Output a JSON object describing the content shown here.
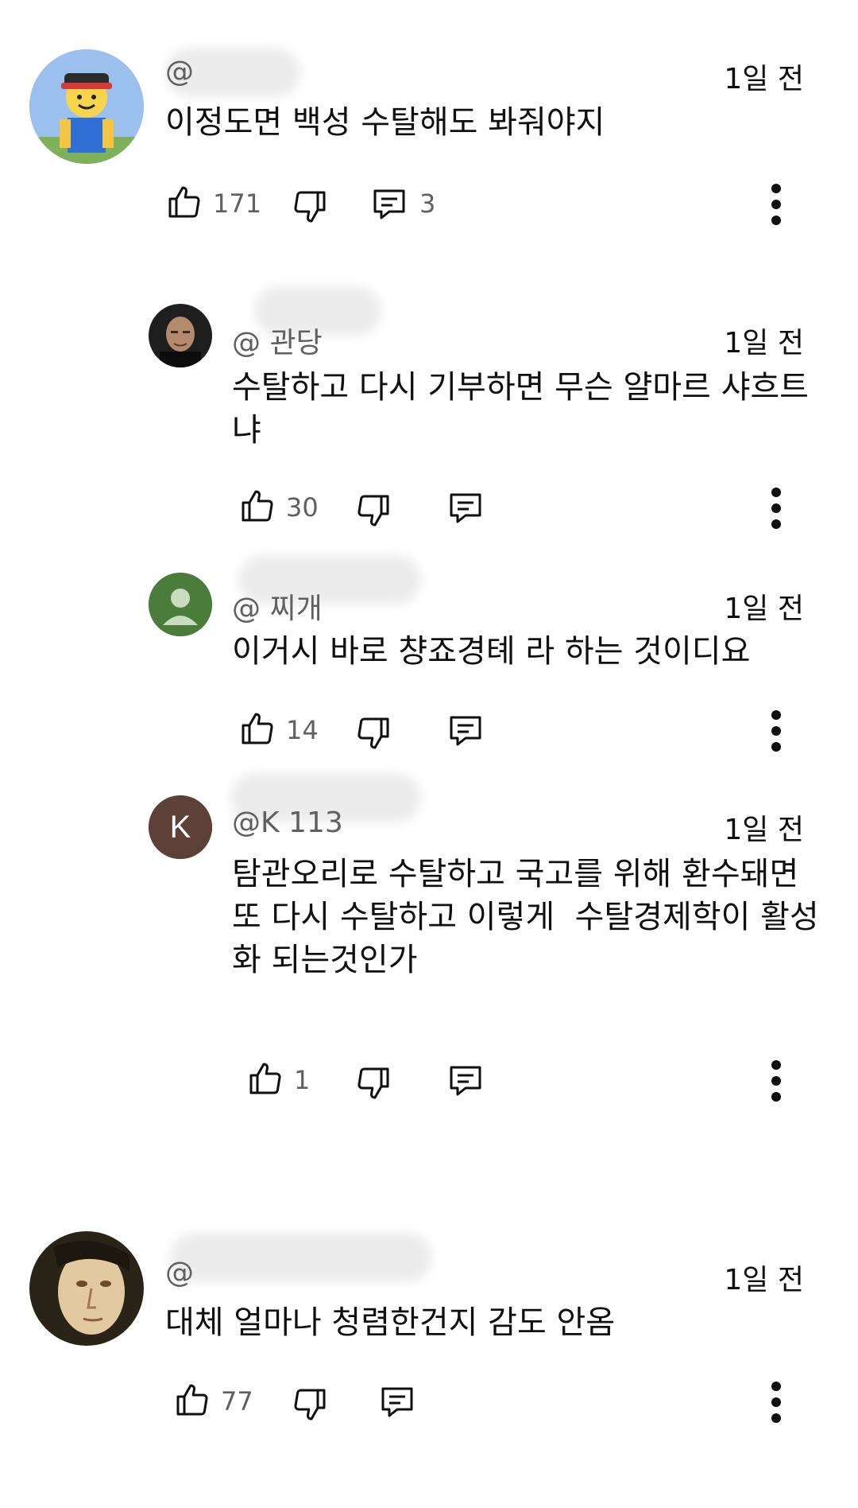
{
  "comments": [
    {
      "author": "@",
      "time": "1일 전",
      "text": "이정도면 백성 수탈해도 봐줘야지",
      "likes": "171",
      "replies": "3",
      "avatar": "roblox-character-avatar"
    },
    {
      "author": "@ 관당",
      "time": "1일 전",
      "text": "수탈하고 다시 기부하면 무슨 얄마르 샤흐트냐",
      "likes": "30",
      "avatar": "bald-man-photo-avatar"
    },
    {
      "author": "@ 찌개",
      "time": "1일 전",
      "text": "이거시 바로 챵죠경톄 라 하는 것이디요",
      "likes": "14",
      "avatar": "default-person-avatar"
    },
    {
      "author": "@K 113",
      "time": "1일 전",
      "text": "탐관오리로 수탈하고 국고를 위해 환수돼면\n또 다시 수탈하고 이렇게  수탈경제학이 활성화 되는것인가",
      "likes": "1",
      "avatar_letter": "K"
    },
    {
      "author": "@",
      "time": "1일 전",
      "text": "대체 얼마나 청렴한건지 감도 안옴",
      "likes": "77",
      "avatar": "portrait-painting-avatar"
    }
  ],
  "colors": {
    "text": "#0f0f0f",
    "secondary": "#606060",
    "avatar_green": "#4a7c3a",
    "avatar_brown": "#5d4037"
  }
}
